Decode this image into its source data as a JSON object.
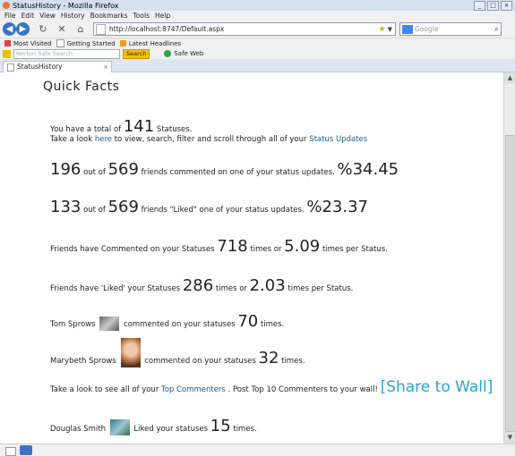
{
  "browser": {
    "window_title": "StatusHistory - Mozilla Firefox",
    "menu": [
      "File",
      "Edit",
      "View",
      "History",
      "Bookmarks",
      "Tools",
      "Help"
    ],
    "url": "http://localhost:8747/Default.aspx",
    "search_placeholder": "Google",
    "bookmarks": [
      "Most Visited",
      "Getting Started",
      "Latest Headlines"
    ],
    "norton_search_placeholder": "Norton Safe Search",
    "norton_search_button": "Search",
    "safe_web": "Safe Web",
    "tab_title": "StatusHistory"
  },
  "page": {
    "heading": "Quick Facts",
    "total": {
      "pre": "You have a total of",
      "value": "141",
      "post": "Statuses."
    },
    "look": {
      "pre": "Take a look",
      "link": "here",
      "mid": "to view, search, filter and scroll through all of your",
      "link2": "Status Updates"
    },
    "commented": {
      "a": "196",
      "t1": "out of",
      "b": "569",
      "t2": "friends commented on one of your status updates.",
      "pct": "%34.45"
    },
    "liked": {
      "a": "133",
      "t1": "out of",
      "b": "569",
      "t2": "friends \"Liked\" one of your status updates.",
      "pct": "%23.37"
    },
    "comment_stats": {
      "t1": "Friends have Commented on your Statuses",
      "a": "718",
      "t2": "times or",
      "b": "5.09",
      "t3": "times per Status."
    },
    "like_stats": {
      "t1": "Friends have 'Liked' your Statuses",
      "a": "286",
      "t2": "times or",
      "b": "2.03",
      "t3": "times per Status."
    },
    "top1": {
      "name": "Tom Sprows",
      "t1": "commented on your statuses",
      "count": "70",
      "t2": "times."
    },
    "top2": {
      "name": "Marybeth Sprows",
      "t1": "commented on your statuses",
      "count": "32",
      "t2": "times."
    },
    "commenters": {
      "pre": "Take a look to see all of your",
      "link": "Top Commenters",
      "post": ". Post Top 10 Commenters to your wall!",
      "share": "[Share to Wall]"
    },
    "liker1": {
      "name": "Douglas Smith",
      "t1": "Liked your statuses",
      "count": "15",
      "t2": "times."
    }
  }
}
